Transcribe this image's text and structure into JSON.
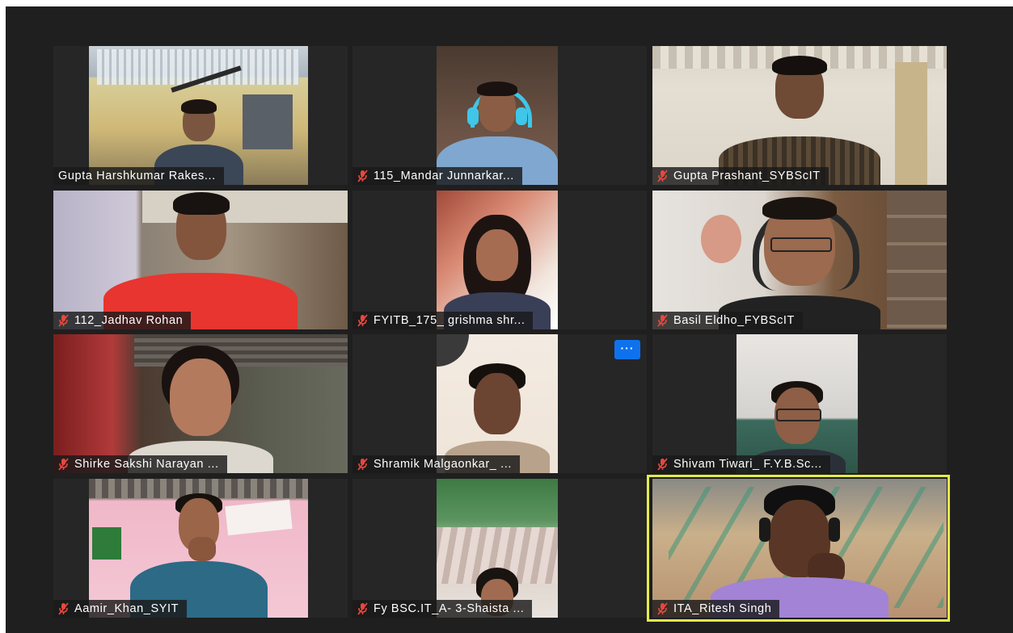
{
  "window": {
    "more_label": "···"
  },
  "participants": [
    {
      "name": "Gupta Harshkumar Rakes...",
      "muted": false
    },
    {
      "name": "115_Mandar Junnarkar...",
      "muted": true
    },
    {
      "name": "Gupta Prashant_SYBScIT",
      "muted": true
    },
    {
      "name": "112_Jadhav Rohan",
      "muted": true
    },
    {
      "name": "FYITB_175_ grishma shr...",
      "muted": true
    },
    {
      "name": "Basil Eldho_FYBScIT",
      "muted": true
    },
    {
      "name": "Shirke Sakshi Narayan ...",
      "muted": true
    },
    {
      "name": "Shramik Malgaonkar_ ...",
      "muted": true
    },
    {
      "name": "Shivam Tiwari_ F.Y.B.Sc...",
      "muted": true
    },
    {
      "name": "Aamir_Khan_SYIT",
      "muted": true
    },
    {
      "name": "Fy BSC.IT_A- 3-Shaista ...",
      "muted": true
    },
    {
      "name": "ITA_Ritesh Singh",
      "muted": true,
      "active_speaker": true
    }
  ],
  "colors": {
    "background": "#1f1f1f",
    "tile": "#262626",
    "active_speaker_border": "#e4ec4a",
    "mute_icon": "#e8473e",
    "more_button": "#0e72ed"
  }
}
